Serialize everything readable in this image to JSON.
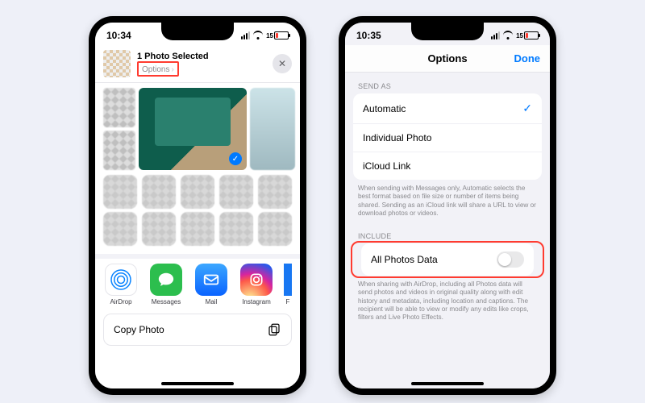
{
  "left": {
    "statusbar_time": "10:34",
    "battery_pct": "15",
    "header_title": "1 Photo Selected",
    "options_label": "Options",
    "apps": {
      "airdrop": "AirDrop",
      "messages": "Messages",
      "mail": "Mail",
      "instagram": "Instagram",
      "facebook_initial": "F"
    },
    "copy_photo": "Copy Photo"
  },
  "right": {
    "statusbar_time": "10:35",
    "battery_pct": "15",
    "nav_title": "Options",
    "done": "Done",
    "send_as_header": "SEND AS",
    "send_as": {
      "automatic": "Automatic",
      "individual": "Individual Photo",
      "icloud": "iCloud Link"
    },
    "send_as_note": "When sending with Messages only, Automatic selects the best format based on file size or number of items being shared. Sending as an iCloud link will share a URL to view or download photos or videos.",
    "include_header": "INCLUDE",
    "all_photos_data": "All Photos Data",
    "include_note": "When sharing with AirDrop, including all Photos data will send photos and videos in original quality along with edit history and metadata, including location and captions. The recipient will be able to view or modify any edits like crops, filters and Live Photo Effects."
  }
}
